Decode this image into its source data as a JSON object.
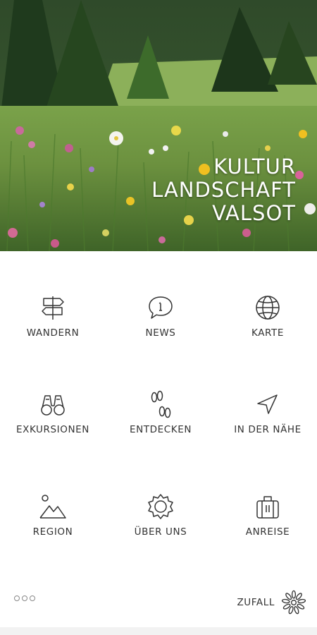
{
  "hero": {
    "title_lines": [
      "KULTUR",
      "LANDSCHAFT",
      "VALSOT"
    ]
  },
  "menu": [
    {
      "label": "WANDERN",
      "icon": "signpost-icon"
    },
    {
      "label": "NEWS",
      "icon": "news-bubble-icon"
    },
    {
      "label": "KARTE",
      "icon": "globe-icon"
    },
    {
      "label": "EXKURSIONEN",
      "icon": "binoculars-icon"
    },
    {
      "label": "ENTDECKEN",
      "icon": "footprints-icon"
    },
    {
      "label": "IN DER NÄHE",
      "icon": "location-arrow-icon"
    },
    {
      "label": "REGION",
      "icon": "mountain-landscape-icon"
    },
    {
      "label": "ÜBER UNS",
      "icon": "flower-badge-icon"
    },
    {
      "label": "ANREISE",
      "icon": "suitcase-icon"
    }
  ],
  "footer": {
    "more_icon": "more-dots-icon",
    "random_label": "ZUFALL",
    "random_icon": "sunburst-icon"
  }
}
